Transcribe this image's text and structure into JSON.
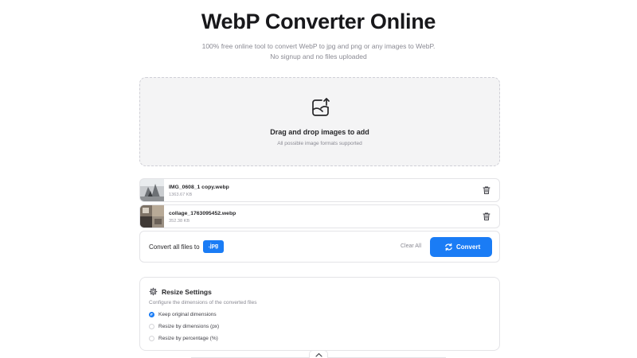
{
  "page": {
    "title": "WebP Converter Online",
    "subtitle": "100% free online tool to convert WebP to jpg and png or any images to WebP. No signup and no files uploaded"
  },
  "dropzone": {
    "icon": "image-upload-icon",
    "title": "Drag and drop images to add",
    "subtitle": "All possible image formats supported"
  },
  "files": [
    {
      "name": "IMG_0608_1 copy.webp",
      "size": "1363.67 KB"
    },
    {
      "name": "collage_1763095452.webp",
      "size": "352.38 KB"
    }
  ],
  "convert_bar": {
    "label": "Convert all files to",
    "format": ".jpg",
    "clear_label": "Clear All",
    "convert_label": "Convert"
  },
  "resize": {
    "title": "Resize Settings",
    "description": "Configure the dimensions of the converted files",
    "options": [
      {
        "label": "Keep original dimensions",
        "selected": true
      },
      {
        "label": "Resize by dimensions (px)",
        "selected": false
      },
      {
        "label": "Resize by percentage (%)",
        "selected": false
      }
    ]
  },
  "colors": {
    "accent": "#1a7cf5",
    "text": "#18181b",
    "muted": "#8a8a93",
    "border": "#e4e4e7",
    "dropzone_bg": "#f4f4f5"
  }
}
